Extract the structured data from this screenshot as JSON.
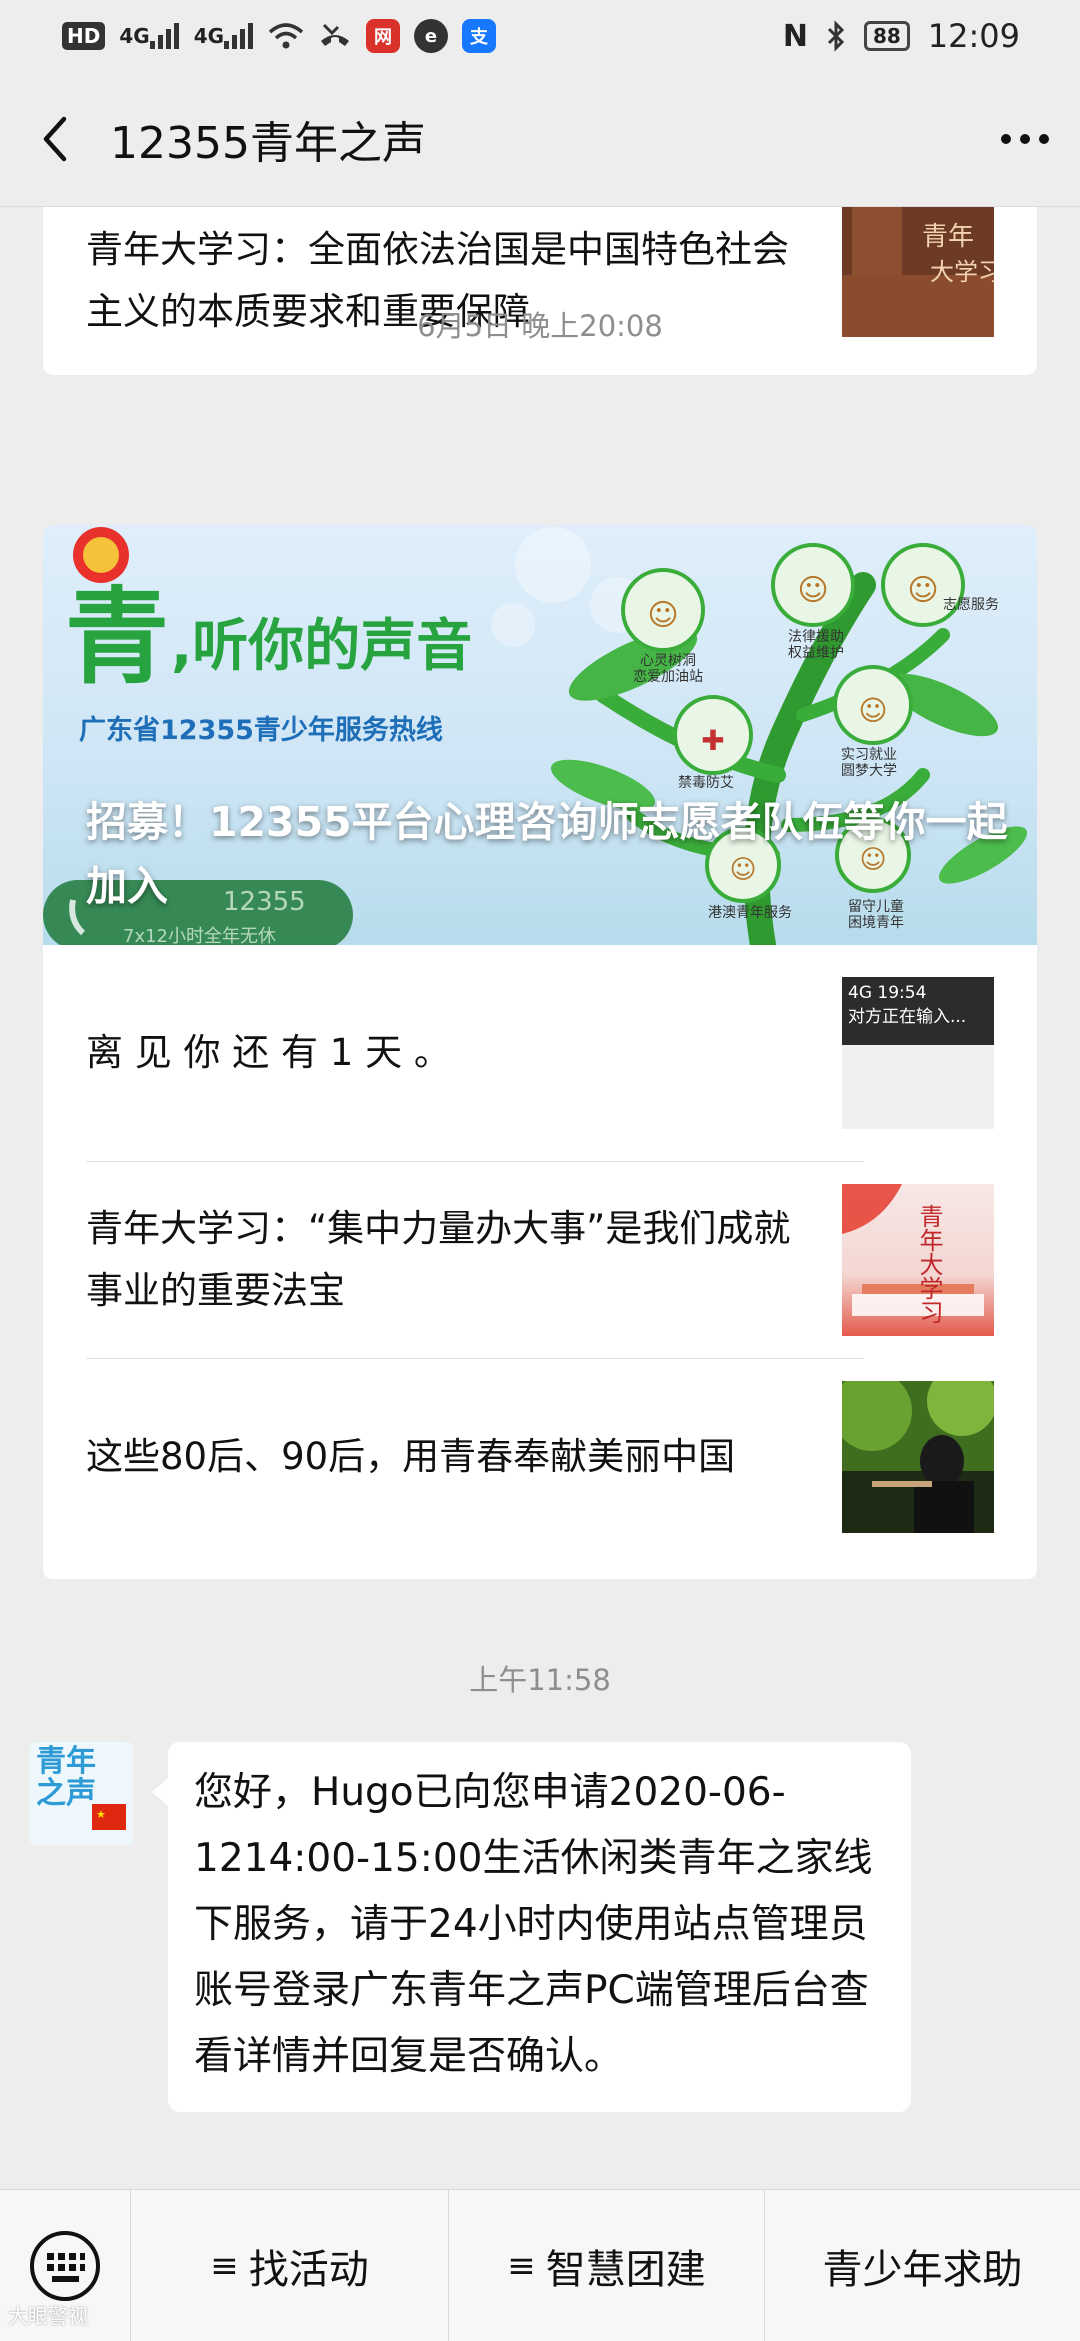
{
  "status_bar": {
    "hd_label": "HD",
    "network_1": "4G",
    "network_2": "4G",
    "battery": "88",
    "time": "12:09"
  },
  "header": {
    "title": "12355青年之声"
  },
  "messages": {
    "top_card": {
      "item_title": "青年大学习：全面依法治国是中国特色社会主义的本质要求和重要保障"
    },
    "timestamp_1": "6月5日 晚上20:08",
    "news_card": {
      "banner": {
        "slogan_main": "青",
        "slogan_rest": ",听你的声音",
        "hotline_text": "广东省12355青少年服务热线",
        "headline": "招募！12355平台心理咨询师志愿者队伍等你一起加入",
        "phone_digits": "12355",
        "phone_hours": "7x12小时全年无休",
        "nodes": [
          "心灵树洞\n恋爱加油站",
          "法律援助\n权益维护",
          "志愿服务",
          "禁毒防艾",
          "实习就业\n圆梦大学",
          "港澳青年服务",
          "留守儿童\n困境青年"
        ]
      },
      "items": [
        {
          "title": "离 见 你 还 有 1 天 。",
          "thumb_text": "4G 19:54\n对方正在输入..."
        },
        {
          "title": "青年大学习：“集中力量办大事”是我们成就事业的重要法宝",
          "thumb_text": "青年大学习"
        },
        {
          "title": "这些80后、90后，用青春奉献美丽中国",
          "thumb_text": ""
        }
      ]
    },
    "timestamp_2": "上午11:58",
    "chat": {
      "avatar_text": "青年之声",
      "text": "您好，Hugo已向您申请2020-06-1214:00-15:00生活休闲类青年之家线下服务，请于24小时内使用站点管理员账号登录广东青年之声PC端管理后台查看详情并回复是否确认。"
    }
  },
  "tabbar": {
    "tabs": [
      {
        "label": "找活动",
        "menu": "≡"
      },
      {
        "label": "智慧团建",
        "menu": "≡"
      },
      {
        "label": "青少年求助",
        "menu": ""
      }
    ]
  },
  "watermark": "大眼警视",
  "colors": {
    "wechat_bg": "#ededed",
    "banner_green": "#27a340",
    "hotline_blue": "#1e6fb8"
  }
}
